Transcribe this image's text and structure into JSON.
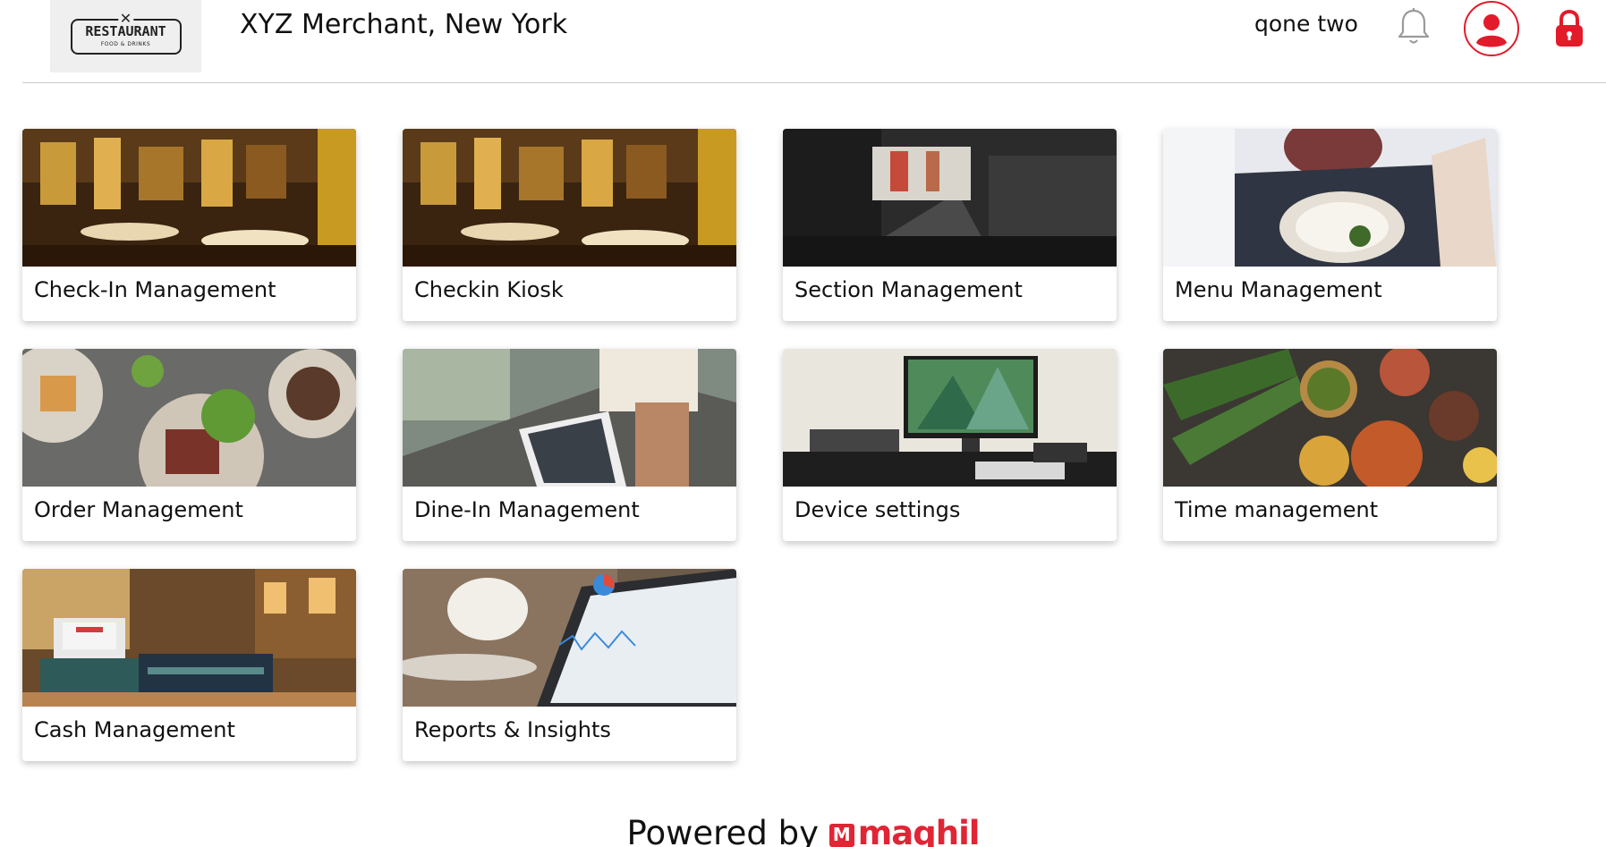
{
  "header": {
    "logo": {
      "title": "RESTAURANT",
      "subtitle": "FOOD & DRINKS"
    },
    "merchant_name": "XYZ Merchant, New York",
    "user_name": "qone two",
    "icons": [
      "bell-icon",
      "user-avatar-icon",
      "lock-icon"
    ]
  },
  "tiles": [
    {
      "label": "Check-In Management",
      "image": "restaurant-interior"
    },
    {
      "label": "Checkin Kiosk",
      "image": "restaurant-interior"
    },
    {
      "label": "Section Management",
      "image": "dark-dining-hall"
    },
    {
      "label": "Menu Management",
      "image": "menu-and-dish"
    },
    {
      "label": "Order Management",
      "image": "plated-dishes"
    },
    {
      "label": "Dine-In Management",
      "image": "tablet-at-table"
    },
    {
      "label": "Device settings",
      "image": "computer-desk"
    },
    {
      "label": "Time management",
      "image": "indian-food-spread"
    },
    {
      "label": "Cash Management",
      "image": "cash-register"
    },
    {
      "label": "Reports & Insights",
      "image": "analytics-tablet"
    }
  ],
  "footer": {
    "powered_by": "Powered by",
    "brand": "maqhil"
  },
  "colors": {
    "accent": "#e21b2a",
    "divider": "#c8c8c8",
    "logo_bg": "#efefef"
  }
}
